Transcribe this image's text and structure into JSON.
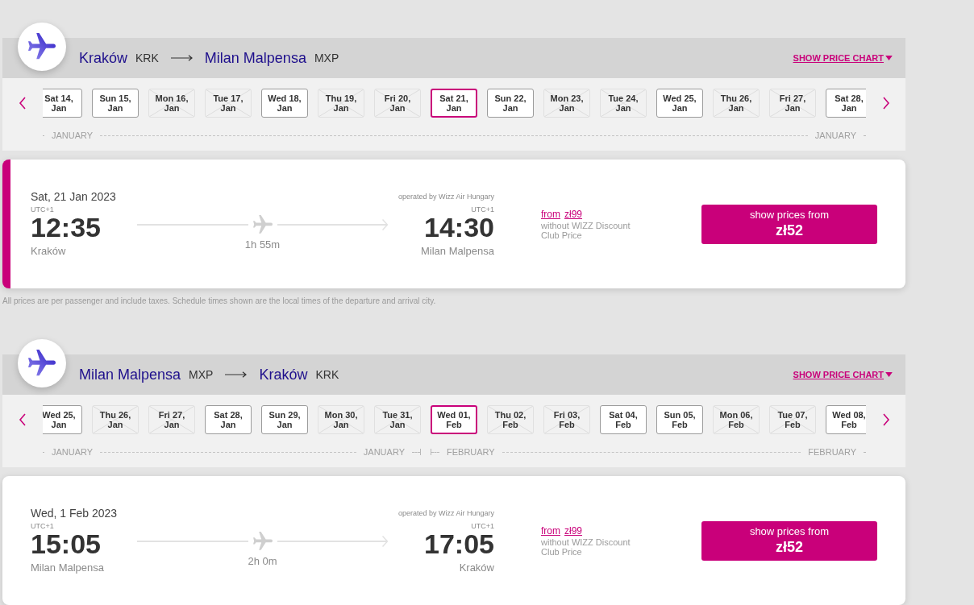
{
  "journeys": [
    {
      "route": {
        "origin_city": "Kraków",
        "origin_code": "KRK",
        "destination_city": "Milan Malpensa",
        "destination_code": "MXP"
      },
      "price_chart_link": "SHOW PRICE CHART",
      "months": [
        {
          "start_label": "JANUARY",
          "end_label": "JANUARY",
          "dates": [
            {
              "day": "Sat 14,",
              "month": "Jan",
              "available": true,
              "selected": false
            },
            {
              "day": "Sun 15,",
              "month": "Jan",
              "available": true,
              "selected": false
            },
            {
              "day": "Mon 16,",
              "month": "Jan",
              "available": false,
              "selected": false
            },
            {
              "day": "Tue 17,",
              "month": "Jan",
              "available": false,
              "selected": false
            },
            {
              "day": "Wed 18,",
              "month": "Jan",
              "available": true,
              "selected": false
            },
            {
              "day": "Thu 19,",
              "month": "Jan",
              "available": false,
              "selected": false
            },
            {
              "day": "Fri 20,",
              "month": "Jan",
              "available": false,
              "selected": false
            },
            {
              "day": "Sat 21,",
              "month": "Jan",
              "available": true,
              "selected": true
            },
            {
              "day": "Sun 22,",
              "month": "Jan",
              "available": true,
              "selected": false
            },
            {
              "day": "Mon 23,",
              "month": "Jan",
              "available": false,
              "selected": false
            },
            {
              "day": "Tue 24,",
              "month": "Jan",
              "available": false,
              "selected": false
            },
            {
              "day": "Wed 25,",
              "month": "Jan",
              "available": true,
              "selected": false
            },
            {
              "day": "Thu 26,",
              "month": "Jan",
              "available": false,
              "selected": false
            },
            {
              "day": "Fri 27,",
              "month": "Jan",
              "available": false,
              "selected": false
            },
            {
              "day": "Sat 28,",
              "month": "Jan",
              "available": true,
              "selected": false
            }
          ]
        }
      ],
      "flight": {
        "selected": true,
        "date": "Sat, 21 Jan 2023",
        "operator": "operated by Wizz Air Hungary",
        "departure": {
          "timezone": "UTC+1",
          "time": "12:35",
          "city": "Kraków"
        },
        "duration": "1h 55m",
        "arrival": {
          "timezone": "UTC+1",
          "time": "14:30",
          "city": "Milan Malpensa"
        },
        "price_note": {
          "from_label": "from",
          "price": "zł99",
          "description": "without WIZZ Discount Club Price"
        },
        "button": {
          "label": "show prices from",
          "price": "zł52"
        }
      },
      "disclaimer": "All prices are per passenger and include taxes. Schedule times shown are the local times of the departure and arrival city."
    },
    {
      "route": {
        "origin_city": "Milan Malpensa",
        "origin_code": "MXP",
        "destination_city": "Kraków",
        "destination_code": "KRK"
      },
      "price_chart_link": "SHOW PRICE CHART",
      "months": [
        {
          "start_label": "JANUARY",
          "end_label": "JANUARY",
          "dates": [
            {
              "day": "Wed 25,",
              "month": "Jan",
              "available": true,
              "selected": false
            },
            {
              "day": "Thu 26,",
              "month": "Jan",
              "available": false,
              "selected": false
            },
            {
              "day": "Fri 27,",
              "month": "Jan",
              "available": false,
              "selected": false
            },
            {
              "day": "Sat 28,",
              "month": "Jan",
              "available": true,
              "selected": false
            },
            {
              "day": "Sun 29,",
              "month": "Jan",
              "available": true,
              "selected": false
            },
            {
              "day": "Mon 30,",
              "month": "Jan",
              "available": false,
              "selected": false
            },
            {
              "day": "Tue 31,",
              "month": "Jan",
              "available": false,
              "selected": false
            }
          ]
        },
        {
          "start_label": "FEBRUARY",
          "end_label": "FEBRUARY",
          "dates": [
            {
              "day": "Wed 01,",
              "month": "Feb",
              "available": true,
              "selected": true
            },
            {
              "day": "Thu 02,",
              "month": "Feb",
              "available": false,
              "selected": false
            },
            {
              "day": "Fri 03,",
              "month": "Feb",
              "available": false,
              "selected": false
            },
            {
              "day": "Sat 04,",
              "month": "Feb",
              "available": true,
              "selected": false
            },
            {
              "day": "Sun 05,",
              "month": "Feb",
              "available": true,
              "selected": false
            },
            {
              "day": "Mon 06,",
              "month": "Feb",
              "available": false,
              "selected": false
            },
            {
              "day": "Tue 07,",
              "month": "Feb",
              "available": false,
              "selected": false
            },
            {
              "day": "Wed 08,",
              "month": "Feb",
              "available": true,
              "selected": false
            }
          ]
        }
      ],
      "flight": {
        "selected": false,
        "date": "Wed, 1 Feb 2023",
        "operator": "operated by Wizz Air Hungary",
        "departure": {
          "timezone": "UTC+1",
          "time": "15:05",
          "city": "Milan Malpensa"
        },
        "duration": "2h 0m",
        "arrival": {
          "timezone": "UTC+1",
          "time": "17:05",
          "city": "Kraków"
        },
        "price_note": {
          "from_label": "from",
          "price": "zł99",
          "description": "without WIZZ Discount Club Price"
        },
        "button": {
          "label": "show prices from",
          "price": "zł52"
        }
      }
    }
  ]
}
